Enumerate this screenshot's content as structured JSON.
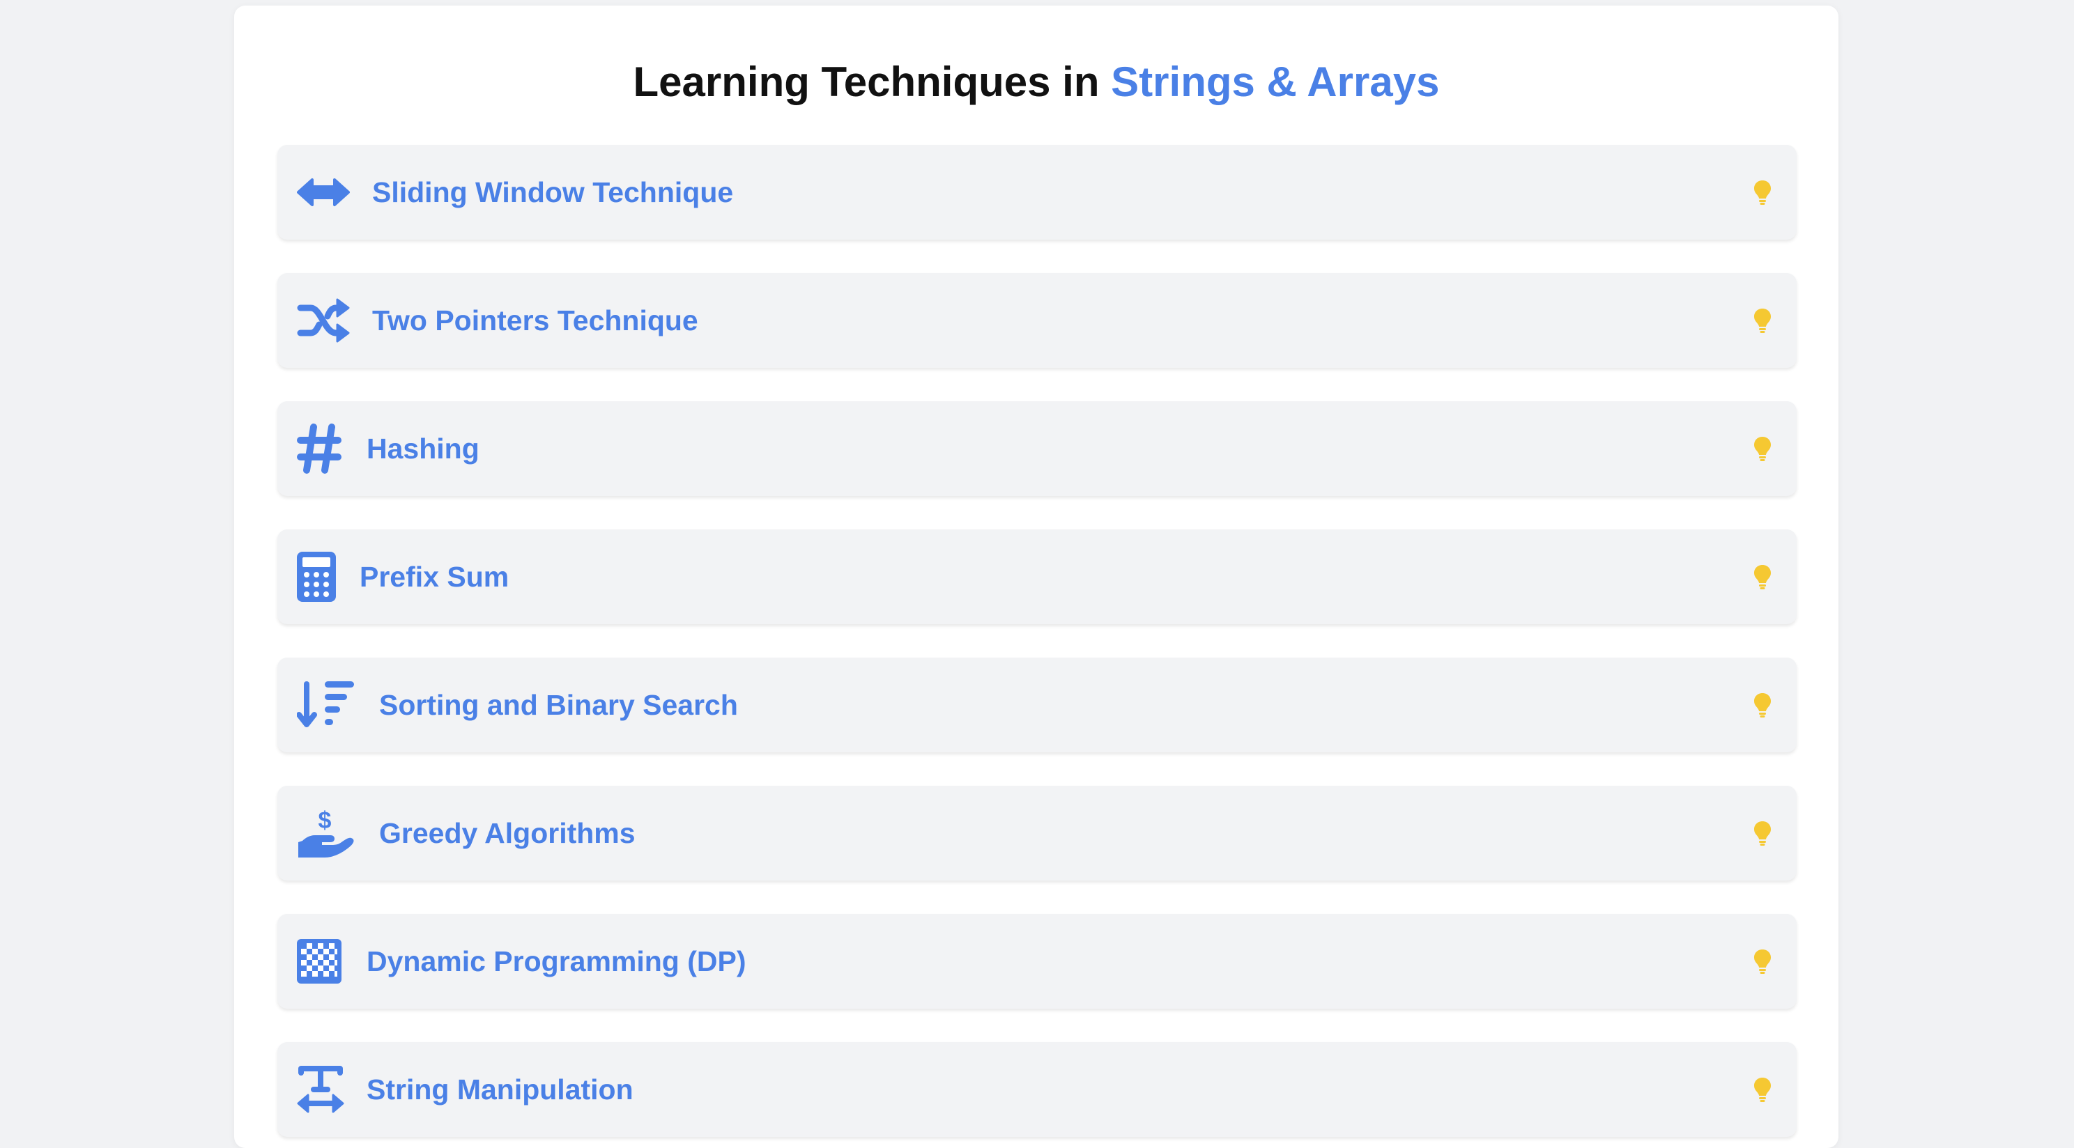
{
  "page": {
    "title_prefix": "Learning Techniques in ",
    "title_accent": "Strings & Arrays"
  },
  "colors": {
    "accent": "#4a80e6",
    "bulb": "#f5c832",
    "item_bg": "#f2f3f5",
    "page_bg": "#f1f2f4"
  },
  "techniques": [
    {
      "label": "Sliding Window Technique",
      "icon": "arrows-left-right-icon",
      "hint_icon": "lightbulb-icon"
    },
    {
      "label": "Two Pointers Technique",
      "icon": "shuffle-icon",
      "hint_icon": "lightbulb-icon"
    },
    {
      "label": "Hashing",
      "icon": "hashtag-icon",
      "hint_icon": "lightbulb-icon"
    },
    {
      "label": "Prefix Sum",
      "icon": "calculator-icon",
      "hint_icon": "lightbulb-icon"
    },
    {
      "label": "Sorting and Binary Search",
      "icon": "sort-descending-icon",
      "hint_icon": "lightbulb-icon"
    },
    {
      "label": "Greedy Algorithms",
      "icon": "hand-holding-dollar-icon",
      "hint_icon": "lightbulb-icon"
    },
    {
      "label": "Dynamic Programming (DP)",
      "icon": "checkerboard-icon",
      "hint_icon": "lightbulb-icon"
    },
    {
      "label": "String Manipulation",
      "icon": "text-width-icon",
      "hint_icon": "lightbulb-icon"
    }
  ]
}
